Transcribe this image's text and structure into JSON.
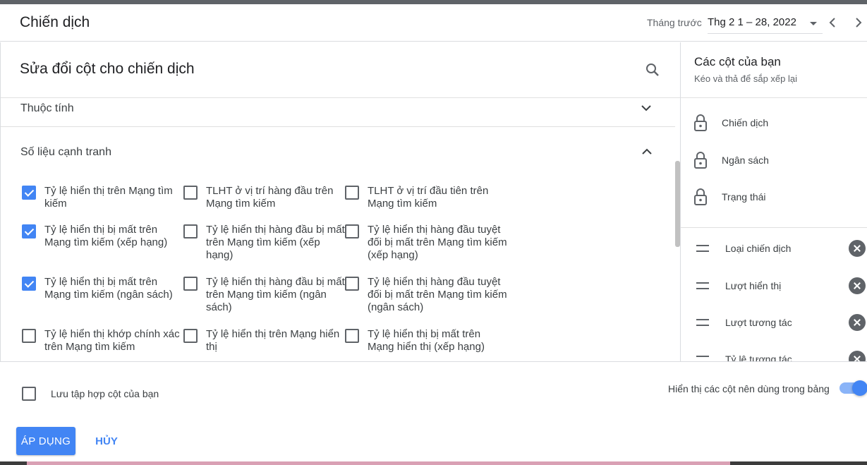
{
  "header": {
    "title": "Chiến dịch",
    "period_label": "Tháng trước",
    "date_range": "Thg 2 1 – 28, 2022"
  },
  "panel": {
    "title": "Sửa đổi cột cho chiến dịch"
  },
  "sections": {
    "attributes": "Thuộc tính",
    "competitive": "Số liệu cạnh tranh"
  },
  "metrics": [
    {
      "label": "Tỷ lệ hiển thị trên Mạng tìm kiếm",
      "checked": true
    },
    {
      "label": "TLHT ở vị trí hàng đầu trên Mạng tìm kiếm",
      "checked": false
    },
    {
      "label": "TLHT ở vị trí đầu tiên trên Mạng tìm kiếm",
      "checked": false
    },
    {
      "label": "Tỷ lệ hiển thị bị mất trên Mạng tìm kiếm (xếp hạng)",
      "checked": true
    },
    {
      "label": "Tỷ lệ hiển thị hàng đầu bị mất trên Mạng tìm kiếm (xếp hạng)",
      "checked": false
    },
    {
      "label": "Tỷ lệ hiển thị hàng đầu tuyệt đối bị mất trên Mạng tìm kiếm (xếp hạng)",
      "checked": false
    },
    {
      "label": "Tỷ lệ hiển thị bị mất trên Mạng tìm kiếm (ngân sách)",
      "checked": true
    },
    {
      "label": "Tỷ lệ hiển thị hàng đầu bị mất trên Mạng tìm kiếm (ngân sách)",
      "checked": false
    },
    {
      "label": "Tỷ lệ hiển thị hàng đầu tuyệt đối bị mất trên Mạng tìm kiếm (ngân sách)",
      "checked": false
    },
    {
      "label": "Tỷ lệ hiển thị khớp chính xác trên Mạng tìm kiếm",
      "checked": false
    },
    {
      "label": "Tỷ lệ hiển thị trên Mạng hiển thị",
      "checked": false
    },
    {
      "label": "Tỷ lệ hiển thị bị mất trên Mạng hiển thị (xếp hạng)",
      "checked": false
    }
  ],
  "sidebar": {
    "title": "Các cột của bạn",
    "subtitle": "Kéo và thả để sắp xếp lại",
    "locked": [
      "Chiến dịch",
      "Ngân sách",
      "Trạng thái"
    ],
    "columns": [
      "Loại chiến dịch",
      "Lượt hiển thị",
      "Lượt tương tác",
      "Tỷ lệ tương tác"
    ]
  },
  "footer": {
    "save_set_label": "Lưu tập hợp cột của bạn",
    "toggle_label": "Hiển thị các cột nên dùng trong bảng",
    "toggle_on": true,
    "apply_label": "ÁP DỤNG",
    "cancel_label": "HỦY"
  },
  "colors": {
    "accent": "#4285f4",
    "text": "#3c4043"
  }
}
